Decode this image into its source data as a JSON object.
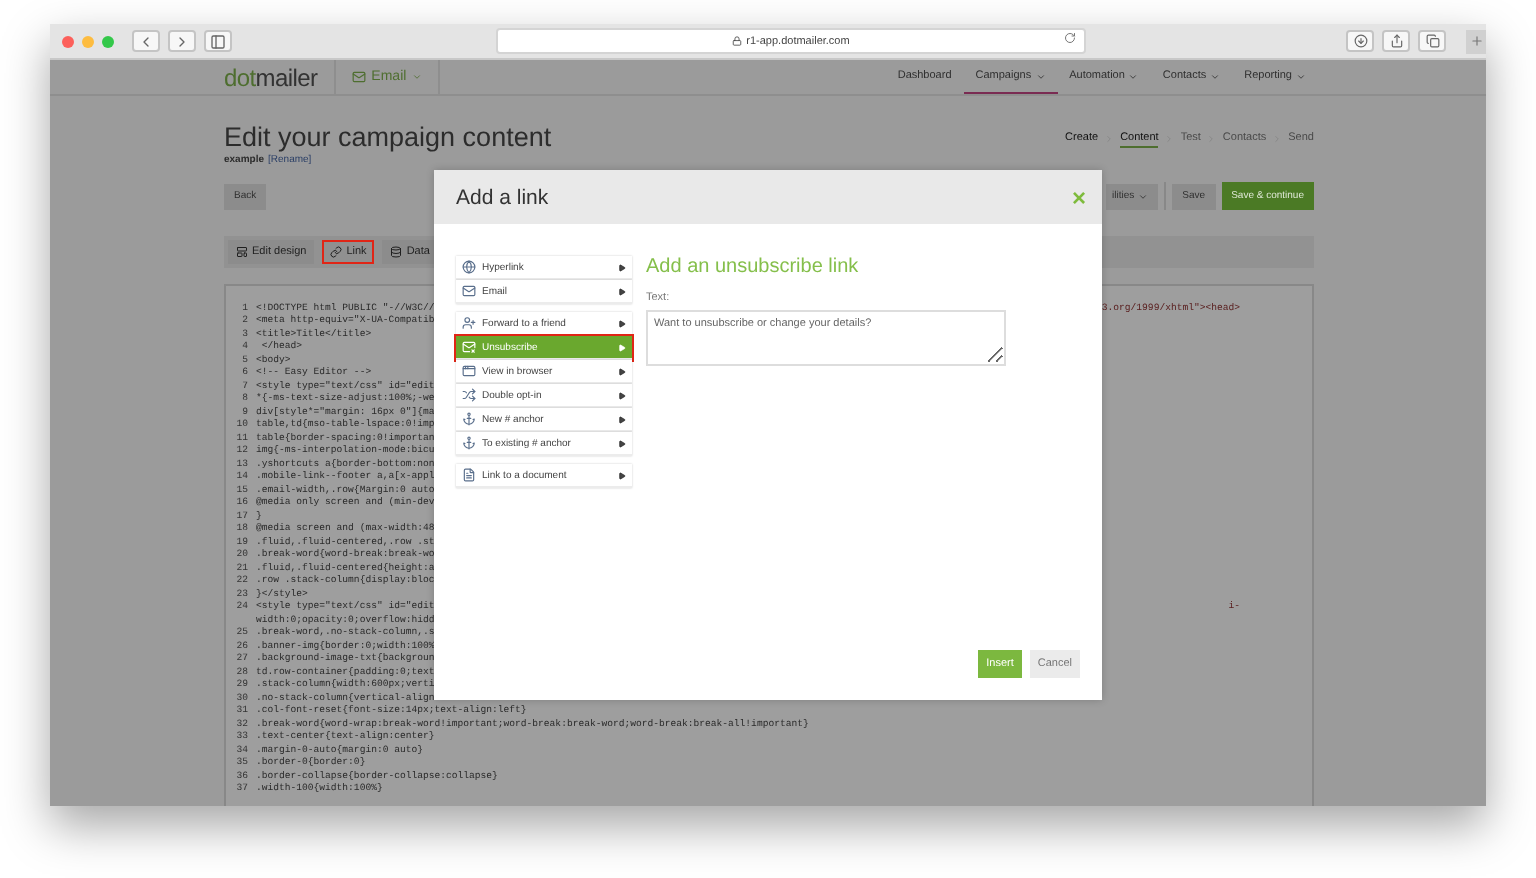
{
  "browser": {
    "url": "r1-app.dotmailer.com"
  },
  "header": {
    "logo": [
      "dot",
      "mailer"
    ],
    "product": "Email",
    "nav": [
      {
        "label": "Dashboard",
        "selected": false,
        "dropdown": false
      },
      {
        "label": "Campaigns",
        "selected": true,
        "dropdown": true
      },
      {
        "label": "Automation",
        "selected": false,
        "dropdown": true
      },
      {
        "label": "Contacts",
        "selected": false,
        "dropdown": true
      },
      {
        "label": "Reporting",
        "selected": false,
        "dropdown": true
      }
    ]
  },
  "page": {
    "title": "Edit your campaign content",
    "campaign_name": "example",
    "rename_link": "[Rename]",
    "steps": [
      {
        "label": "Create",
        "selected": false,
        "disabled": false
      },
      {
        "label": "Content",
        "selected": true,
        "disabled": false
      },
      {
        "label": "Test",
        "selected": false,
        "disabled": true
      },
      {
        "label": "Contacts",
        "selected": false,
        "disabled": true
      },
      {
        "label": "Send",
        "selected": false,
        "disabled": true
      }
    ],
    "back_button": "Back",
    "utilities_button": "ilities",
    "save_button": "Save",
    "save_continue_button": "Save & continue"
  },
  "editor_toolbar": [
    {
      "label": "Edit design",
      "highlighted": false
    },
    {
      "label": "Link",
      "highlighted": true
    },
    {
      "label": "Data",
      "highlighted": false
    }
  ],
  "code": [
    {
      "number": "1",
      "text": "<!DOCTYPE html PUBLIC \"-//W3C//",
      "tail": "3.org/1999/xhtml\"><head>"
    },
    {
      "number": "2",
      "text": "<meta http-equiv=\"X-UA-Compatib"
    },
    {
      "number": "3",
      "text": "<title>Title</title>"
    },
    {
      "number": "4",
      "text": " </head>"
    },
    {
      "number": "5",
      "text": "<body>"
    },
    {
      "number": "6",
      "text": "<!-- Easy Editor -->"
    },
    {
      "number": "7",
      "text": "<style type=\"text/css\" id=\"edit"
    },
    {
      "number": "8",
      "text": "*{-ms-text-size-adjust:100%;-we"
    },
    {
      "number": "9",
      "text": "div[style*=\"margin: 16px 0\"]{ma"
    },
    {
      "number": "10",
      "text": "table,td{mso-table-lspace:0!imp"
    },
    {
      "number": "11",
      "text": "table{border-spacing:0!importan"
    },
    {
      "number": "12",
      "text": "img{-ms-interpolation-mode:bicu"
    },
    {
      "number": "13",
      "text": ".yshortcuts a{border-bottom:non"
    },
    {
      "number": "14",
      "text": ".mobile-link--footer a,a[x-appl"
    },
    {
      "number": "15",
      "text": ".email-width,.row{Margin:0 auto"
    },
    {
      "number": "16",
      "text": "@media only screen and (min-dev"
    },
    {
      "number": "17",
      "text": "}"
    },
    {
      "number": "18",
      "text": "@media screen and (max-width:48"
    },
    {
      "number": "19",
      "text": ".fluid,.fluid-centered,.row .st"
    },
    {
      "number": "20",
      "text": ".break-word{word-break:break-wo"
    },
    {
      "number": "21",
      "text": ".fluid,.fluid-centered{height:a"
    },
    {
      "number": "22",
      "text": ".row .stack-column{display:bloc"
    },
    {
      "number": "23",
      "text": "}</style>"
    },
    {
      "number": "24",
      "text": "<style type=\"text/css\" id=\"edit",
      "tail": "i-",
      "wrap": "width:0;opacity:0;overflow:hidd"
    },
    {
      "number": "25",
      "text": ".break-word,.no-stack-column,.s"
    },
    {
      "number": "26",
      "text": ".banner-img{border:0;width:100%"
    },
    {
      "number": "27",
      "text": ".background-image-txt{backgroun"
    },
    {
      "number": "28",
      "text": "td.row-container{padding:0;text"
    },
    {
      "number": "29",
      "text": ".stack-column{width:600px;verti"
    },
    {
      "number": "30",
      "text": ".no-stack-column{vertical-align"
    },
    {
      "number": "31",
      "text": ".col-font-reset{font-size:14px;text-align:left}"
    },
    {
      "number": "32",
      "text": ".break-word{word-wrap:break-word!important;word-break:break-word;word-break:break-all!important}"
    },
    {
      "number": "33",
      "text": ".text-center{text-align:center}"
    },
    {
      "number": "34",
      "text": ".margin-0-auto{margin:0 auto}"
    },
    {
      "number": "35",
      "text": ".border-0{border:0}"
    },
    {
      "number": "36",
      "text": ".border-collapse{border-collapse:collapse}"
    },
    {
      "number": "37",
      "text": ".width-100{width:100%}"
    }
  ],
  "dialog": {
    "title": "Add a link",
    "close": "×",
    "menu_groups": [
      [
        {
          "label": "Hyperlink",
          "selected": false,
          "highlighted": false
        },
        {
          "label": "Email",
          "selected": false,
          "highlighted": false
        }
      ],
      [
        {
          "label": "Forward to a friend",
          "selected": false,
          "highlighted": false
        },
        {
          "label": "Unsubscribe",
          "selected": true,
          "highlighted": true
        },
        {
          "label": "View in browser",
          "selected": false,
          "highlighted": false
        },
        {
          "label": "Double opt-in",
          "selected": false,
          "highlighted": false
        },
        {
          "label": "New # anchor",
          "selected": false,
          "highlighted": false
        },
        {
          "label": "To existing # anchor",
          "selected": false,
          "highlighted": false
        }
      ],
      [
        {
          "label": "Link to a document",
          "selected": false,
          "highlighted": false
        }
      ]
    ],
    "heading": "Add an unsubscribe link",
    "text_label": "Text:",
    "text_value": "Want to unsubscribe or change your details?",
    "insert_button": "Insert",
    "cancel_button": "Cancel"
  }
}
